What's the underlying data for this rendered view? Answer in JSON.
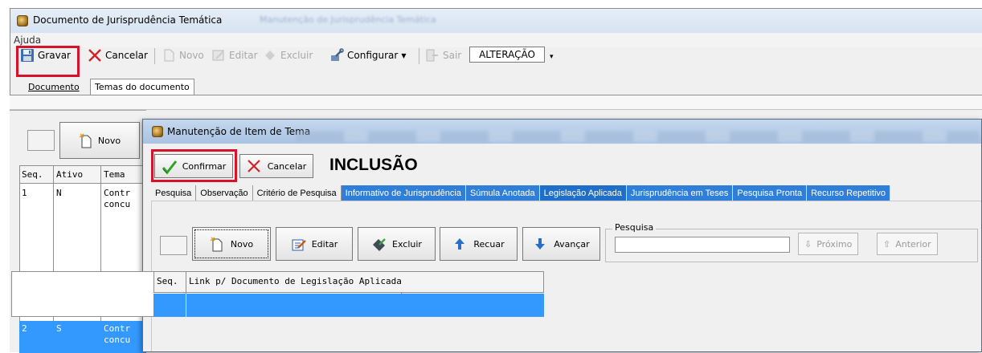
{
  "window": {
    "title": "Documento de Jurisprudência Temática",
    "title_blur": "Manutenção de Jurisprudência Temática"
  },
  "menu": {
    "ajuda": "Ajuda"
  },
  "toolbar": {
    "gravar": "Gravar",
    "cancelar": "Cancelar",
    "novo": "Novo",
    "editar": "Editar",
    "excluir": "Excluir",
    "configurar": "Configurar",
    "sair": "Sair",
    "mode": "ALTERAÇÃO"
  },
  "tabs": {
    "documento": "Documento",
    "temas": "Temas do documento"
  },
  "left_panel": {
    "novo": "Novo",
    "columns": [
      "Seq.",
      "Ativo",
      "Tema"
    ],
    "rows": [
      {
        "seq": "1",
        "ativo": "N",
        "tema1": "Contr",
        "tema2": "concu"
      },
      {
        "seq": "2",
        "ativo": "S",
        "tema1": "Contr",
        "tema2": "concu"
      }
    ]
  },
  "dialog": {
    "title": "Manutenção de Item de Tema",
    "confirmar": "Confirmar",
    "cancelar": "Cancelar",
    "mode": "INCLUSÃO",
    "tabs": [
      "Pesquisa",
      "Observação",
      "Critério de Pesquisa",
      "Informativo de Jurisprudência",
      "Súmula Anotada",
      "Legislação Aplicada",
      "Jurisprudência em Teses",
      "Pesquisa Pronta",
      "Recurso Repetitivo"
    ],
    "buttons": {
      "novo": "Novo",
      "editar": "Editar",
      "excluir": "Excluir",
      "recuar": "Recuar",
      "avancar": "Avançar"
    },
    "pesquisa": {
      "label": "Pesquisa",
      "value": "",
      "proximo": "Próximo",
      "anterior": "Anterior"
    },
    "grid": {
      "col_seq": "Seq.",
      "col_link": "Link p/ Documento de Legislação Aplicada"
    }
  },
  "colors": {
    "highlight": "#d8122a",
    "selection": "#3399ff",
    "tab_blue": "#2f7fd8"
  }
}
